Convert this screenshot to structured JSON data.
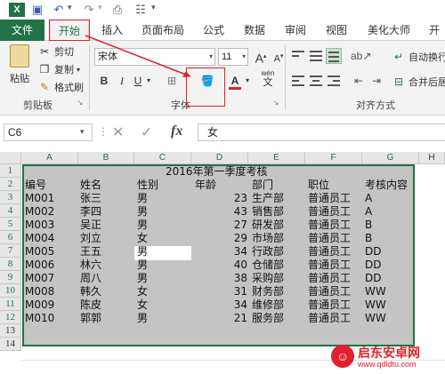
{
  "ribbon_tabs": [
    {
      "label": "文件"
    },
    {
      "label": "开始"
    },
    {
      "label": "插入"
    },
    {
      "label": "页面布局"
    },
    {
      "label": "公式"
    },
    {
      "label": "数据"
    },
    {
      "label": "审阅"
    },
    {
      "label": "视图"
    },
    {
      "label": "美化大师"
    },
    {
      "label": "开"
    }
  ],
  "clipboard": {
    "paste": "粘贴",
    "cut": "剪切",
    "copy": "复制",
    "format_painter": "格式刷",
    "group_label": "剪贴板"
  },
  "font": {
    "name": "宋体",
    "size": "11",
    "bold": "B",
    "italic": "I",
    "underline": "U",
    "font_color_glyph": "A",
    "wen_glyph": "wén",
    "grow": "A",
    "shrink": "A",
    "group_label": "字体"
  },
  "alignment": {
    "wrap_text": "自动换行",
    "merge_center": "合并后居",
    "group_label": "对齐方式"
  },
  "formula_bar": {
    "name_box": "C6",
    "fx": "fx",
    "value": "女"
  },
  "columns": [
    "A",
    "B",
    "C",
    "D",
    "E",
    "F",
    "G",
    "H"
  ],
  "rows": [
    "1",
    "2",
    "3",
    "4",
    "5",
    "6",
    "7",
    "8",
    "9",
    "10",
    "11",
    "12",
    "13",
    "14"
  ],
  "sheet": {
    "title": "2016年第一季度考核",
    "headers": [
      "编号",
      "姓名",
      "性别",
      "年龄",
      "部门",
      "职位",
      "考核内容"
    ],
    "data": [
      [
        "M001",
        "张三",
        "男",
        "23",
        "生产部",
        "普通员工",
        "A"
      ],
      [
        "M002",
        "李四",
        "男",
        "43",
        "销售部",
        "普通员工",
        "A"
      ],
      [
        "M003",
        "吴正",
        "男",
        "27",
        "研发部",
        "普通员工",
        "B"
      ],
      [
        "M004",
        "刘立",
        "女",
        "29",
        "市场部",
        "普通员工",
        "B"
      ],
      [
        "M005",
        "王五",
        "男",
        "34",
        "行政部",
        "普通员工",
        "DD"
      ],
      [
        "M006",
        "林六",
        "男",
        "40",
        "仓储部",
        "普通员工",
        "DD"
      ],
      [
        "M007",
        "周八",
        "男",
        "38",
        "采购部",
        "普通员工",
        "DD"
      ],
      [
        "M008",
        "韩久",
        "女",
        "31",
        "财务部",
        "普通员工",
        "WW"
      ],
      [
        "M009",
        "陈皮",
        "女",
        "34",
        "维修部",
        "普通员工",
        "WW"
      ],
      [
        "M010",
        "郭郭",
        "男",
        "21",
        "服务部",
        "普通员工",
        "WW"
      ]
    ]
  },
  "watermark": {
    "line1": "启东安卓网",
    "line2": "www.qdldtu.com"
  },
  "colors": {
    "excel_green": "#217346",
    "highlight_red": "#e0202a"
  }
}
